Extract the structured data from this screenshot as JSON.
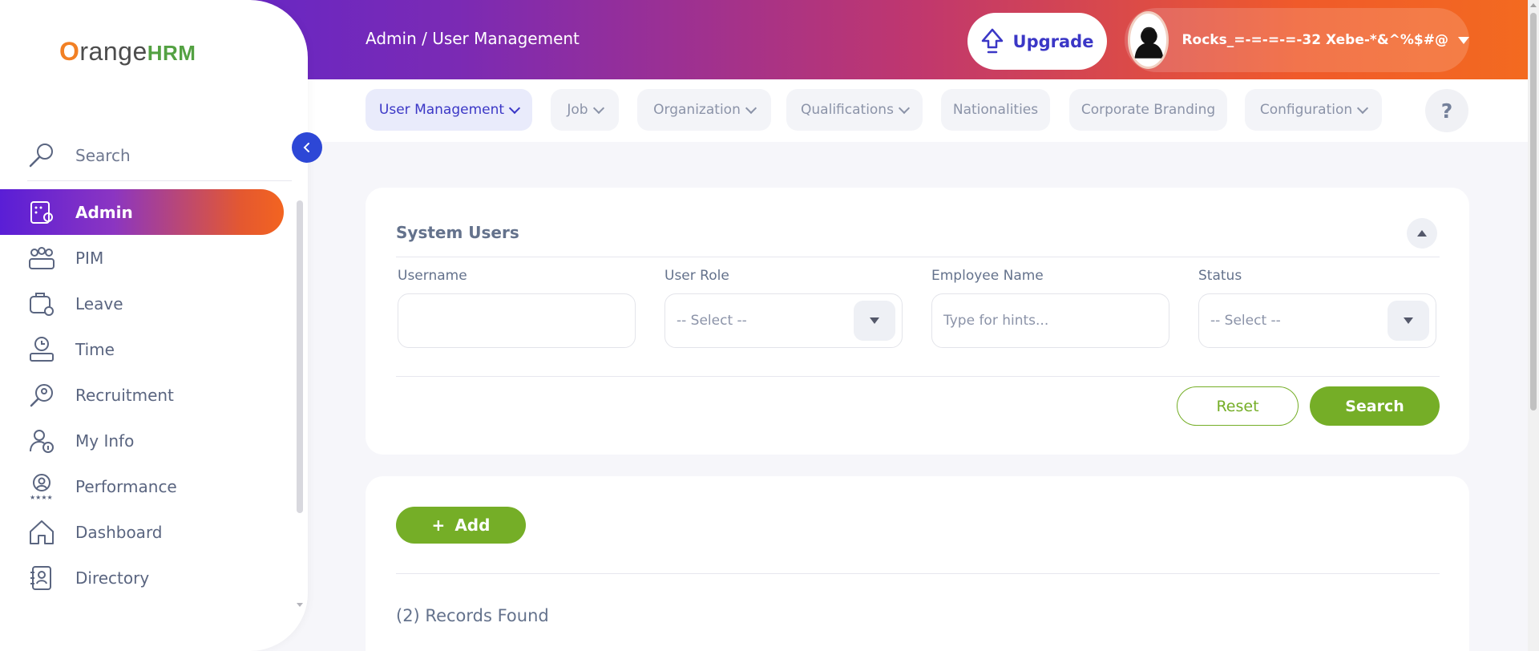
{
  "brand": {
    "logo_o": "O",
    "logo_range": "range",
    "logo_hrm": "HRM"
  },
  "header": {
    "breadcrumb": "Admin / User Management",
    "upgrade_label": "Upgrade",
    "user_name": "Rocks_=-=-=-=-32 Xebe-*&^%$#@"
  },
  "subnav": {
    "items": [
      {
        "label": "User Management"
      },
      {
        "label": "Job"
      },
      {
        "label": "Organization"
      },
      {
        "label": "Qualifications"
      },
      {
        "label": "Nationalities"
      },
      {
        "label": "Corporate Branding"
      },
      {
        "label": "Configuration"
      }
    ],
    "help_label": "?"
  },
  "sidebar": {
    "search_label": "Search",
    "items": [
      {
        "label": "Admin",
        "icon": "admin-icon"
      },
      {
        "label": "PIM",
        "icon": "pim-icon"
      },
      {
        "label": "Leave",
        "icon": "leave-icon"
      },
      {
        "label": "Time",
        "icon": "time-icon"
      },
      {
        "label": "Recruitment",
        "icon": "recruitment-icon"
      },
      {
        "label": "My Info",
        "icon": "my-info-icon"
      },
      {
        "label": "Performance",
        "icon": "performance-icon"
      },
      {
        "label": "Dashboard",
        "icon": "dashboard-icon"
      },
      {
        "label": "Directory",
        "icon": "directory-icon"
      }
    ]
  },
  "filter": {
    "title": "System Users",
    "fields": {
      "username": {
        "label": "Username",
        "value": ""
      },
      "user_role": {
        "label": "User Role",
        "value": "-- Select --"
      },
      "employee_name": {
        "label": "Employee Name",
        "placeholder": "Type for hints..."
      },
      "status": {
        "label": "Status",
        "value": "-- Select --"
      }
    },
    "reset_label": "Reset",
    "search_label": "Search"
  },
  "results": {
    "add_label": "Add",
    "add_symbol": "+",
    "records_found": "(2) Records Found"
  },
  "colors": {
    "accent_green": "#75ae27",
    "brand_blue": "#3b37c6",
    "header_gradient_start": "#5224d6",
    "header_gradient_end": "#f36a20"
  }
}
